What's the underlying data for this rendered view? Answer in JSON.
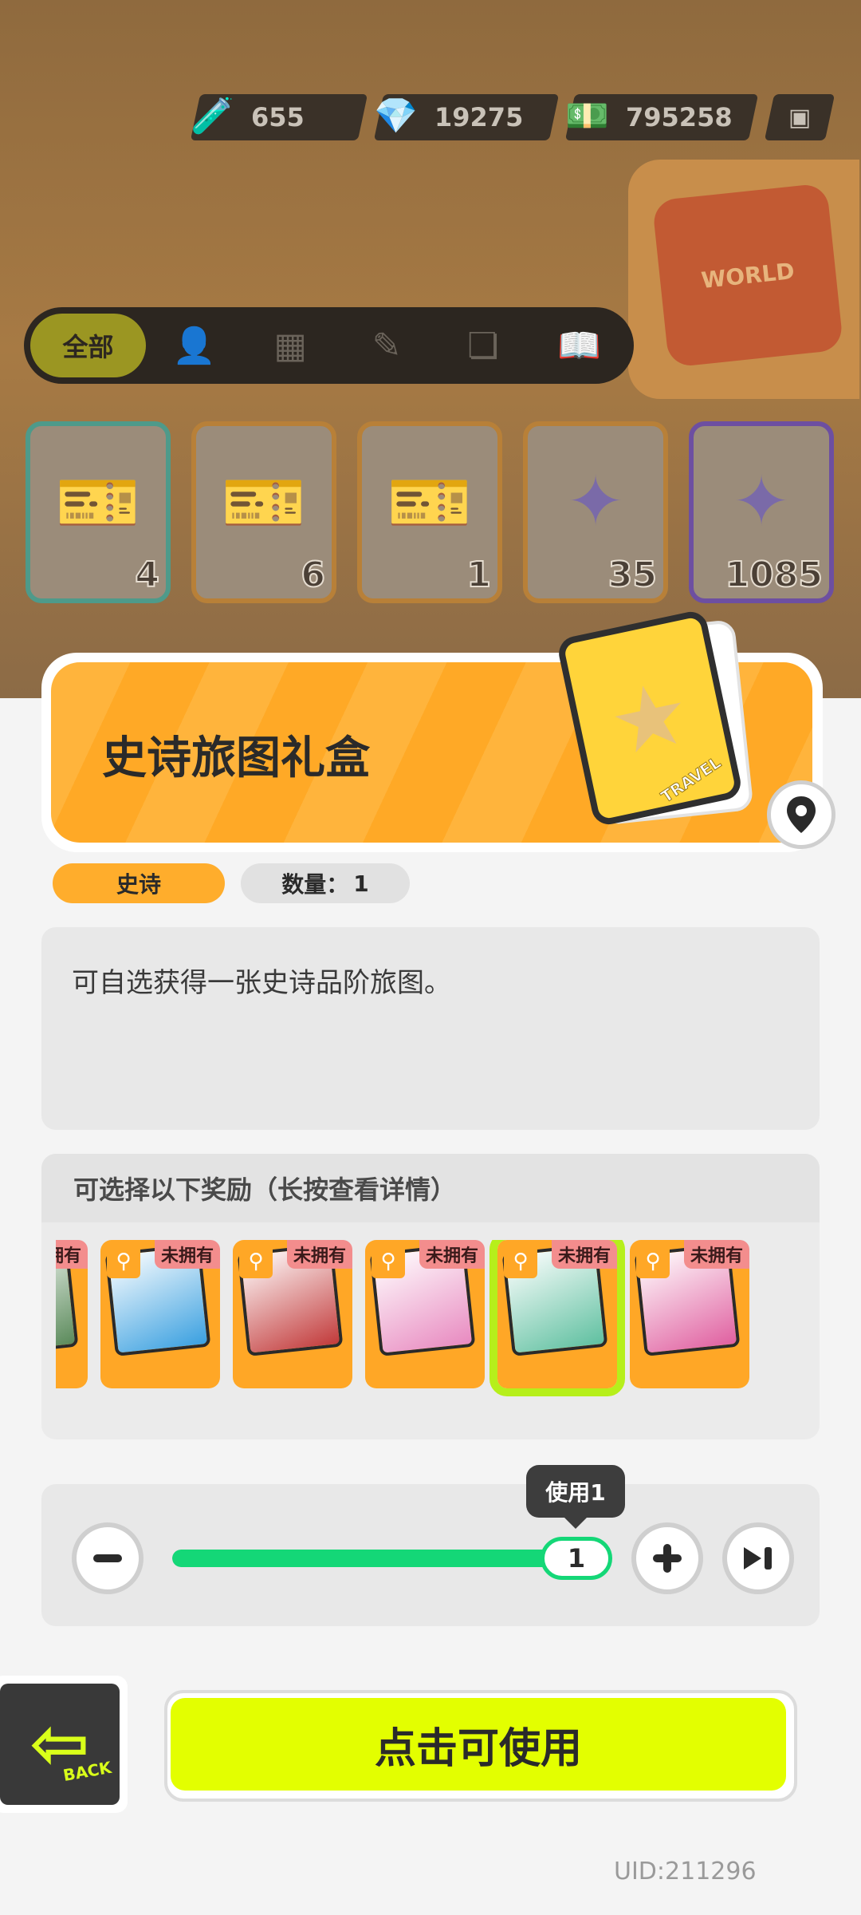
{
  "currencies": [
    {
      "icon": "potion-icon",
      "value": "655"
    },
    {
      "icon": "diamond-icon",
      "value": "19275"
    },
    {
      "icon": "cash-icon",
      "value": "795258"
    }
  ],
  "world_card": {
    "label": "WORLD"
  },
  "filter_tabs": {
    "all": "全部",
    "icons": [
      "person-icon",
      "box-icon",
      "brush-icon",
      "cards-icon",
      "book-icon"
    ]
  },
  "inventory": [
    {
      "count": "4"
    },
    {
      "count": "6"
    },
    {
      "count": "1"
    },
    {
      "count": "35"
    },
    {
      "count": "1085"
    }
  ],
  "item": {
    "title": "史诗旅图礼盒",
    "card_tag": "TRAVEL",
    "rarity": "史诗",
    "quantity_label": "数量：",
    "quantity": "1",
    "description": "可自选获得一张史诗品阶旅图。"
  },
  "rewards": {
    "heading": "可选择以下奖励（长按查看详情）",
    "owned_label": "未拥有",
    "cards": [
      {
        "color": "#5a8a5a"
      },
      {
        "color": "#3aa0e0"
      },
      {
        "color": "#c23a3a"
      },
      {
        "color": "#e88ac0"
      },
      {
        "color": "#5fc0a0"
      },
      {
        "color": "#e060a0"
      }
    ],
    "selected_index": 4
  },
  "use": {
    "tooltip": "使用1",
    "value": "1",
    "fill_fraction": 1.0
  },
  "back": {
    "label": "BACK"
  },
  "use_button": {
    "label": "点击可使用"
  },
  "uid": "UID:211296"
}
